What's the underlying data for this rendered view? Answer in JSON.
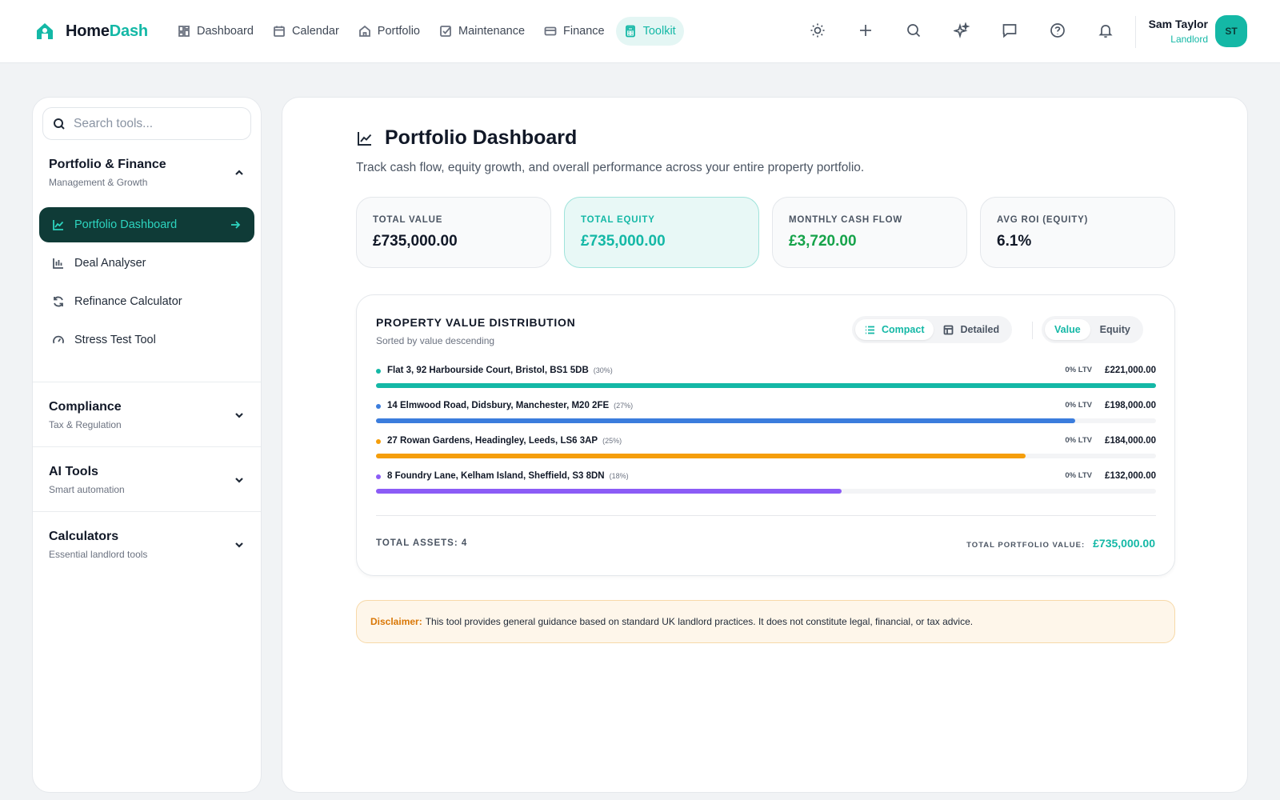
{
  "brand": {
    "part1": "Home",
    "part2": "Dash"
  },
  "nav": [
    {
      "label": "Dashboard",
      "icon": "grid-icon"
    },
    {
      "label": "Calendar",
      "icon": "calendar-icon"
    },
    {
      "label": "Portfolio",
      "icon": "home-icon"
    },
    {
      "label": "Maintenance",
      "icon": "checkbox-icon"
    },
    {
      "label": "Finance",
      "icon": "card-icon"
    },
    {
      "label": "Toolkit",
      "icon": "calculator-icon",
      "active": true
    }
  ],
  "header_tools": [
    "sun-icon",
    "plus-icon",
    "search-icon",
    "sparkle-icon",
    "chat-icon",
    "help-icon",
    "bell-icon"
  ],
  "user": {
    "name": "Sam Taylor",
    "role": "Landlord",
    "initials": "ST"
  },
  "sidebar": {
    "search_placeholder": "Search tools...",
    "sections": [
      {
        "title": "Portfolio & Finance",
        "subtitle": "Management & Growth",
        "expanded": true,
        "items": [
          {
            "label": "Portfolio Dashboard",
            "icon": "line-chart-icon",
            "active": true
          },
          {
            "label": "Deal Analyser",
            "icon": "bar-chart-icon"
          },
          {
            "label": "Refinance Calculator",
            "icon": "refresh-icon"
          },
          {
            "label": "Stress Test Tool",
            "icon": "gauge-icon"
          }
        ]
      },
      {
        "title": "Compliance",
        "subtitle": "Tax & Regulation",
        "expanded": false
      },
      {
        "title": "AI Tools",
        "subtitle": "Smart automation",
        "expanded": false
      },
      {
        "title": "Calculators",
        "subtitle": "Essential landlord tools",
        "expanded": false
      }
    ]
  },
  "page": {
    "title": "Portfolio Dashboard",
    "description": "Track cash flow, equity growth, and overall performance across your entire property portfolio."
  },
  "stats": [
    {
      "label": "TOTAL VALUE",
      "value": "£735,000.00"
    },
    {
      "label": "TOTAL EQUITY",
      "value": "£735,000.00"
    },
    {
      "label": "MONTHLY CASH FLOW",
      "value": "£3,720.00"
    },
    {
      "label": "AVG ROI (EQUITY)",
      "value": "6.1%"
    }
  ],
  "distribution": {
    "title": "PROPERTY VALUE DISTRIBUTION",
    "subtitle": "Sorted by value descending",
    "view_toggle": {
      "options": [
        "Compact",
        "Detailed"
      ],
      "selected": "Compact"
    },
    "metric_toggle": {
      "options": [
        "Value",
        "Equity"
      ],
      "selected": "Value"
    },
    "properties": [
      {
        "address": "Flat 3, 92 Harbourside Court, Bristol, BS1 5DB",
        "share": "(30%)",
        "ltv": "0% LTV",
        "value": "£221,000.00",
        "amount": 221000,
        "color": "#14b8a6"
      },
      {
        "address": "14 Elmwood Road, Didsbury, Manchester, M20 2FE",
        "share": "(27%)",
        "ltv": "0% LTV",
        "value": "£198,000.00",
        "amount": 198000,
        "color": "#3b7ddd"
      },
      {
        "address": "27 Rowan Gardens, Headingley, Leeds, LS6 3AP",
        "share": "(25%)",
        "ltv": "0% LTV",
        "value": "£184,000.00",
        "amount": 184000,
        "color": "#f59e0b"
      },
      {
        "address": "8 Foundry Lane, Kelham Island, Sheffield, S3 8DN",
        "share": "(18%)",
        "ltv": "0% LTV",
        "value": "£132,000.00",
        "amount": 132000,
        "color": "#8b5cf6"
      }
    ],
    "total_assets_label": "TOTAL ASSETS: 4",
    "total_value_label": "TOTAL PORTFOLIO VALUE:",
    "total_value": "£735,000.00"
  },
  "disclaimer": {
    "label": "Disclaimer:",
    "text": "This tool provides general guidance based on standard UK landlord practices. It does not constitute legal, financial, or tax advice."
  },
  "colors": {
    "accent": "#14b8a6",
    "dark_accent": "#0f3b37",
    "positive": "#16a34a",
    "warning": "#d97706"
  }
}
